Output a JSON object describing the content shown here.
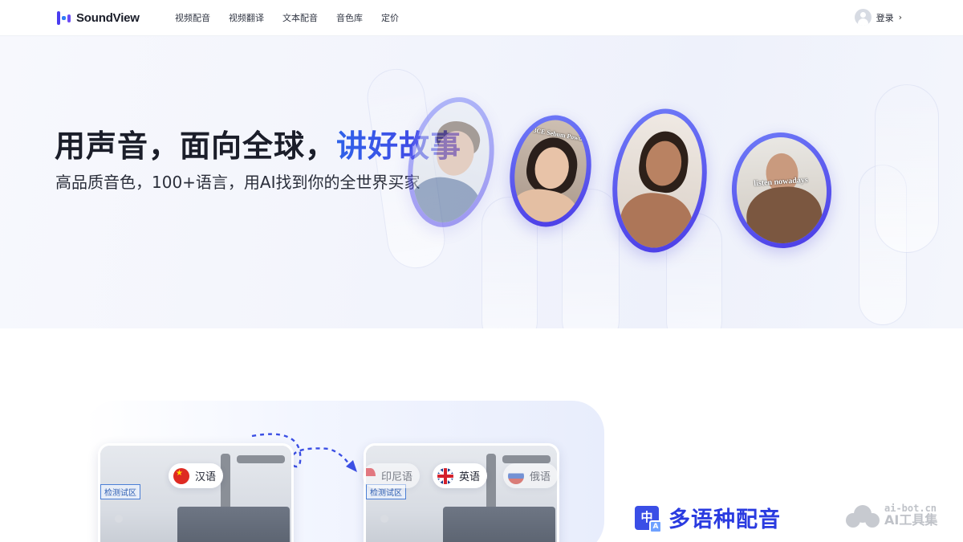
{
  "header": {
    "brand": "SoundView",
    "nav": [
      "视频配音",
      "视频翻译",
      "文本配音",
      "音色库",
      "定价"
    ],
    "login_label": "登录",
    "login_chevron": "›"
  },
  "hero": {
    "title_main": "用声音，面向全球，",
    "title_accent": "讲好故事",
    "subtitle": "高品质音色，100+语言，用AI找到你的全世界买家",
    "captions": [
      "3CE Sebum Powder",
      "listen nowadays"
    ],
    "accent_color": "#3b4fe4"
  },
  "section2": {
    "source_lang": "汉语",
    "target_langs": [
      "印尼语",
      "英语",
      "俄语"
    ],
    "sign_text": "检测试区",
    "feature_title": "多语种配音",
    "feature_icon_glyph": "中",
    "feature_icon_sub": "A"
  },
  "watermark": {
    "domain": "ai-bot.cn",
    "name": "AI工具集"
  }
}
